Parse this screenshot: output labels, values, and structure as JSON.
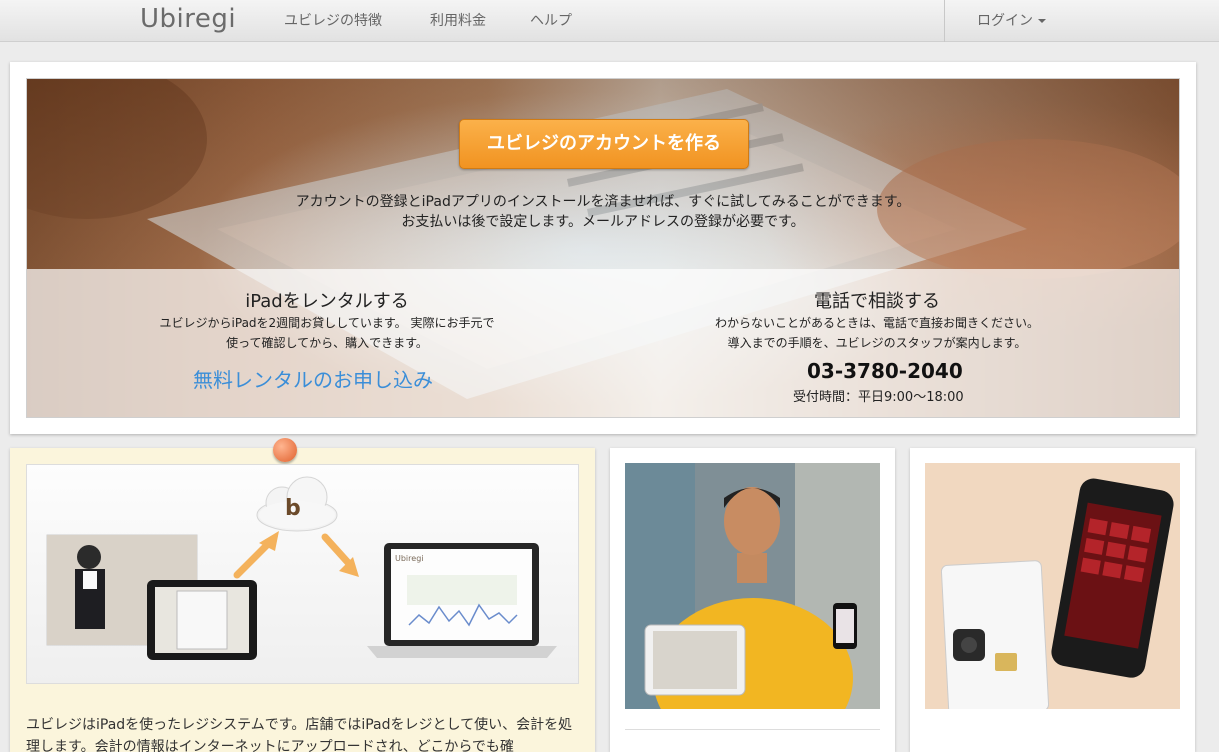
{
  "nav": {
    "logo": "Ubiregi",
    "links": [
      "ユビレジの特徴",
      "利用料金",
      "ヘルプ"
    ],
    "login": "ログイン"
  },
  "hero": {
    "cta": "ユビレジのアカウントを作る",
    "desc_line1": "アカウントの登録とiPadアプリのインストールを済ませれば、すぐに試してみることができます。",
    "desc_line2": "お支払いは後で設定します。メールアドレスの登録が必要です。",
    "rental": {
      "title": "iPadをレンタルする",
      "text_line1": "ユビレジからiPadを2週間お貸ししています。 実際にお手元で",
      "text_line2": "使って確認してから、購入できます。",
      "link": "無料レンタルのお申し込み"
    },
    "phone": {
      "title": "電話で相談する",
      "text_line1": "わからないことがあるときは、電話で直接お聞きください。",
      "text_line2": "導入までの手順を、ユビレジのスタッフが案内します。",
      "number": "03-3780-2040",
      "hours": "受付時間：平日9:00〜18:00"
    }
  },
  "feature": {
    "text": "ユビレジはiPadを使ったレジシステムです。店舗ではiPadをレジとして使い、会計を処理します。会計の情報はインターネットにアップロードされ、どこからでも確"
  },
  "colors": {
    "cta": "#f19321",
    "link": "#3b8ed8"
  }
}
